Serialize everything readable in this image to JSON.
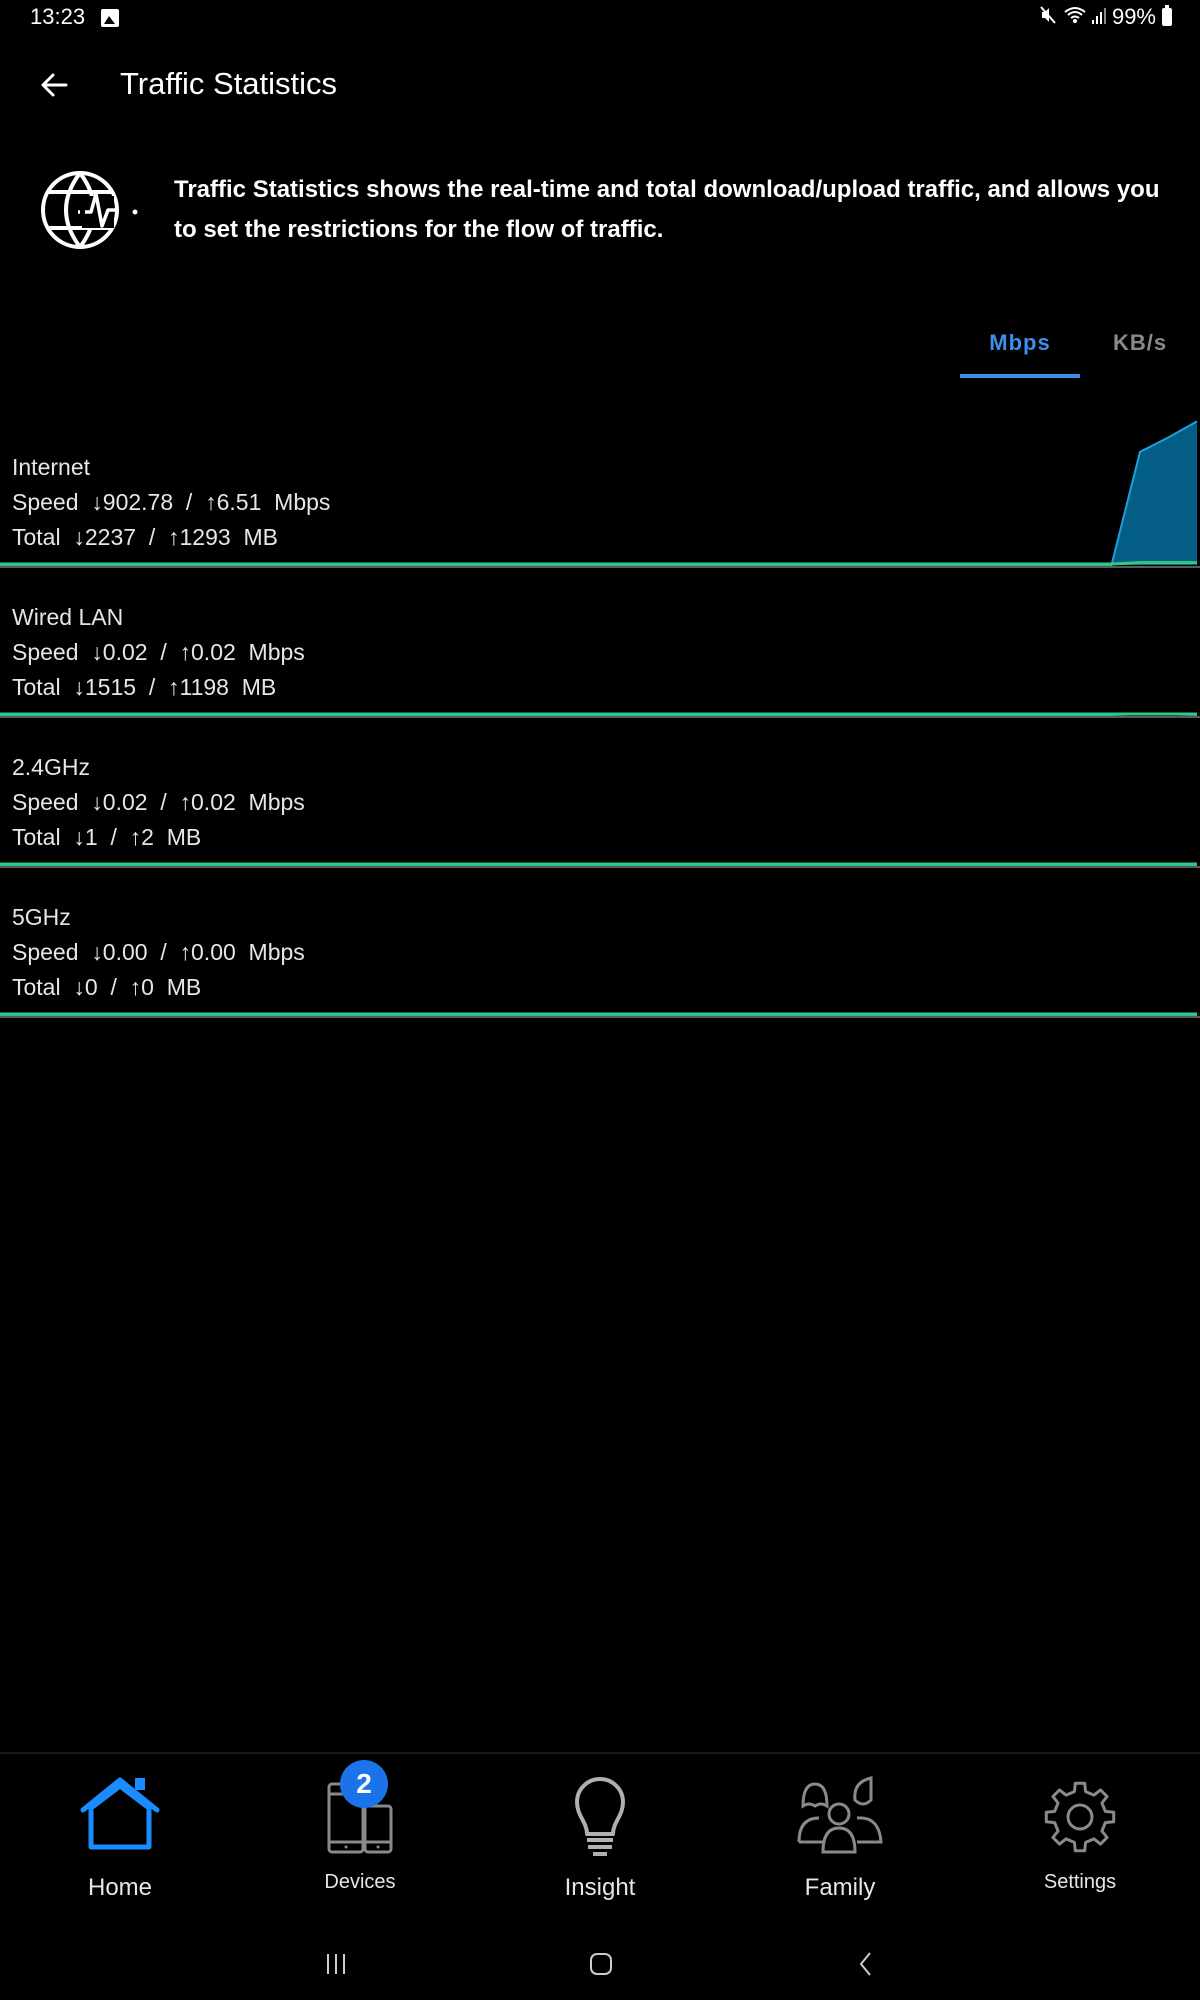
{
  "status_bar": {
    "time": "13:23",
    "battery": "99%",
    "icons": [
      "image-icon",
      "mute-icon",
      "wifi-icon",
      "signal-icon",
      "battery-icon"
    ]
  },
  "app_bar": {
    "title": "Traffic Statistics",
    "back_icon": "arrow-left-icon"
  },
  "intro": {
    "icon": "globe-pulse-icon",
    "text": "Traffic Statistics shows the real-time and total download/upload traffic, and allows you to set the restrictions for the flow of traffic."
  },
  "unit_tabs": [
    {
      "label": "Mbps",
      "active": true
    },
    {
      "label": "KB/s",
      "active": false
    }
  ],
  "stats": [
    {
      "name": "Internet",
      "speed_label": "Speed",
      "speed_down": "902.78",
      "speed_up": "6.51",
      "speed_unit": "Mbps",
      "total_label": "Total",
      "total_down": "2237",
      "total_up": "1293",
      "total_unit": "MB",
      "download_history": [
        0,
        0,
        0,
        0,
        0,
        0,
        0,
        0,
        0,
        0,
        0,
        0,
        0,
        0,
        0,
        0,
        0,
        0,
        0,
        0,
        0,
        0,
        0,
        0,
        0,
        0,
        0,
        0,
        0,
        0,
        0,
        0,
        0,
        0,
        0,
        0,
        0,
        0,
        0,
        0.0,
        0.78,
        0.88,
        0.99
      ],
      "upload_history": [
        0,
        0,
        0,
        0,
        0,
        0,
        0,
        0,
        0,
        0,
        0,
        0,
        0,
        0,
        0,
        0,
        0,
        0,
        0,
        0,
        0,
        0,
        0,
        0,
        0,
        0,
        0,
        0,
        0,
        0,
        0,
        0,
        0,
        0,
        0,
        0,
        0,
        0,
        0,
        0.0,
        0.01,
        0.01,
        0.01
      ]
    },
    {
      "name": "Wired LAN",
      "speed_label": "Speed",
      "speed_down": "0.02",
      "speed_up": "0.02",
      "speed_unit": "Mbps",
      "total_label": "Total",
      "total_down": "1515",
      "total_up": "1198",
      "total_unit": "MB",
      "download_history": [
        0,
        0,
        0,
        0,
        0,
        0,
        0,
        0,
        0,
        0,
        0,
        0,
        0,
        0,
        0,
        0,
        0,
        0,
        0,
        0,
        0,
        0,
        0,
        0,
        0,
        0,
        0,
        0,
        0,
        0,
        0,
        0,
        0,
        0,
        0,
        0,
        0,
        0,
        0,
        0,
        0.005,
        0.005,
        0
      ],
      "upload_history": [
        0,
        0,
        0,
        0,
        0,
        0,
        0,
        0,
        0,
        0,
        0,
        0,
        0,
        0,
        0,
        0,
        0,
        0,
        0,
        0,
        0,
        0,
        0,
        0,
        0,
        0,
        0,
        0,
        0,
        0,
        0,
        0,
        0,
        0,
        0,
        0,
        0,
        0,
        0,
        0,
        0,
        0,
        0
      ]
    },
    {
      "name": "2.4GHz",
      "speed_label": "Speed",
      "speed_down": "0.02",
      "speed_up": "0.02",
      "speed_unit": "Mbps",
      "total_label": "Total",
      "total_down": "1",
      "total_up": "2",
      "total_unit": "MB",
      "download_history": [
        0,
        0,
        0,
        0,
        0,
        0,
        0,
        0,
        0,
        0,
        0,
        0,
        0,
        0,
        0,
        0,
        0,
        0,
        0,
        0,
        0,
        0,
        0,
        0,
        0,
        0,
        0,
        0,
        0,
        0,
        0,
        0,
        0,
        0,
        0,
        0,
        0,
        0,
        0,
        0,
        0,
        0,
        0
      ],
      "upload_history": [
        0,
        0,
        0,
        0,
        0,
        0,
        0,
        0,
        0,
        0,
        0,
        0,
        0,
        0,
        0,
        0,
        0,
        0,
        0,
        0,
        0,
        0,
        0,
        0,
        0,
        0,
        0,
        0,
        0,
        0,
        0,
        0,
        0,
        0,
        0,
        0,
        0,
        0,
        0,
        0,
        0,
        0,
        0
      ]
    },
    {
      "name": "5GHz",
      "speed_label": "Speed",
      "speed_down": "0.00",
      "speed_up": "0.00",
      "speed_unit": "Mbps",
      "total_label": "Total",
      "total_down": "0",
      "total_up": "0",
      "total_unit": "MB",
      "download_history": [
        0,
        0,
        0,
        0,
        0,
        0,
        0,
        0,
        0,
        0,
        0,
        0,
        0,
        0,
        0,
        0,
        0,
        0,
        0,
        0,
        0,
        0,
        0,
        0,
        0,
        0,
        0,
        0,
        0,
        0,
        0,
        0,
        0,
        0,
        0,
        0,
        0,
        0,
        0,
        0,
        0,
        0,
        0
      ],
      "upload_history": [
        0,
        0,
        0,
        0,
        0,
        0,
        0,
        0,
        0,
        0,
        0,
        0,
        0,
        0,
        0,
        0,
        0,
        0,
        0,
        0,
        0,
        0,
        0,
        0,
        0,
        0,
        0,
        0,
        0,
        0,
        0,
        0,
        0,
        0,
        0,
        0,
        0,
        0,
        0,
        0,
        0,
        0,
        0
      ]
    }
  ],
  "arrows": {
    "down": "↓",
    "up": "↑",
    "separator": "/"
  },
  "colors": {
    "accent": "#3b8eea",
    "download_fill": "#035d85",
    "download_line": "#1da1e0",
    "upload_line": "#2ecc80",
    "baseline": "#5a5a5a",
    "badge": "#1a73e8"
  },
  "bottom_nav": [
    {
      "label": "Home",
      "icon": "home-icon",
      "active": true
    },
    {
      "label": "Devices",
      "icon": "devices-icon",
      "active": false,
      "badge": "2"
    },
    {
      "label": "Insight",
      "icon": "lightbulb-icon",
      "active": false
    },
    {
      "label": "Family",
      "icon": "family-icon",
      "active": false
    },
    {
      "label": "Settings",
      "icon": "gear-icon",
      "active": false
    }
  ],
  "system_nav": [
    "recent-apps-icon",
    "home-circle-icon",
    "back-chevron-icon"
  ]
}
